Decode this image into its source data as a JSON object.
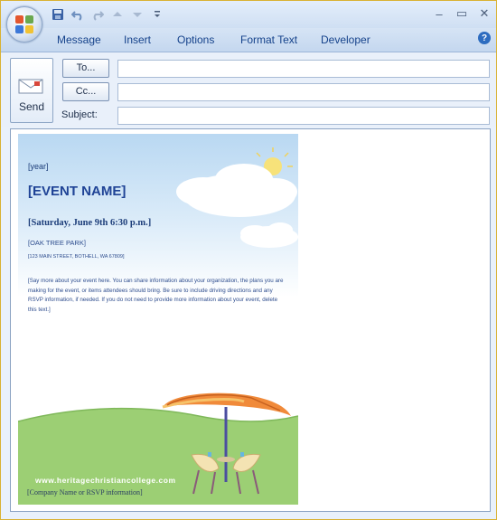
{
  "quick_access": {
    "icons": [
      "save-icon",
      "undo-icon",
      "redo-icon",
      "up-arrow-icon",
      "down-arrow-icon",
      "customize-icon"
    ]
  },
  "window_controls": {
    "minimize": "–",
    "maximize": "▭",
    "close": "✕"
  },
  "ribbon": {
    "tabs": [
      "Message",
      "Insert",
      "Options",
      "Format Text",
      "Developer"
    ],
    "help": "?"
  },
  "header": {
    "send_label": "Send",
    "to_label": "To...",
    "cc_label": "Cc...",
    "subject_label": "Subject:",
    "to_value": "",
    "cc_value": "",
    "subject_value": ""
  },
  "flyer": {
    "year": "[year]",
    "event_name": "[EVENT NAME]",
    "date_time": "[Saturday, June 9th 6:30 p.m.]",
    "place": "[OAK TREE PARK]",
    "address": "[123 MAIN STREET, BOTHELL, WA 67809]",
    "details": "[Say more about your event here. You can share information about your organization, the plans you are making for the event, or items attendees should bring. Be sure to include driving directions and any RSVP information, if needed. If you do not need to provide more information about your event, delete this text.]",
    "website": "www.heritagechristiancollege.com",
    "company": "[Company Name or RSVP information]"
  },
  "colors": {
    "title_accent": "#15428b",
    "frame_border": "#d9b233",
    "event_title": "#1f4396",
    "umbrella_orange": "#f08a3a",
    "grass_green": "#9ccf74"
  }
}
